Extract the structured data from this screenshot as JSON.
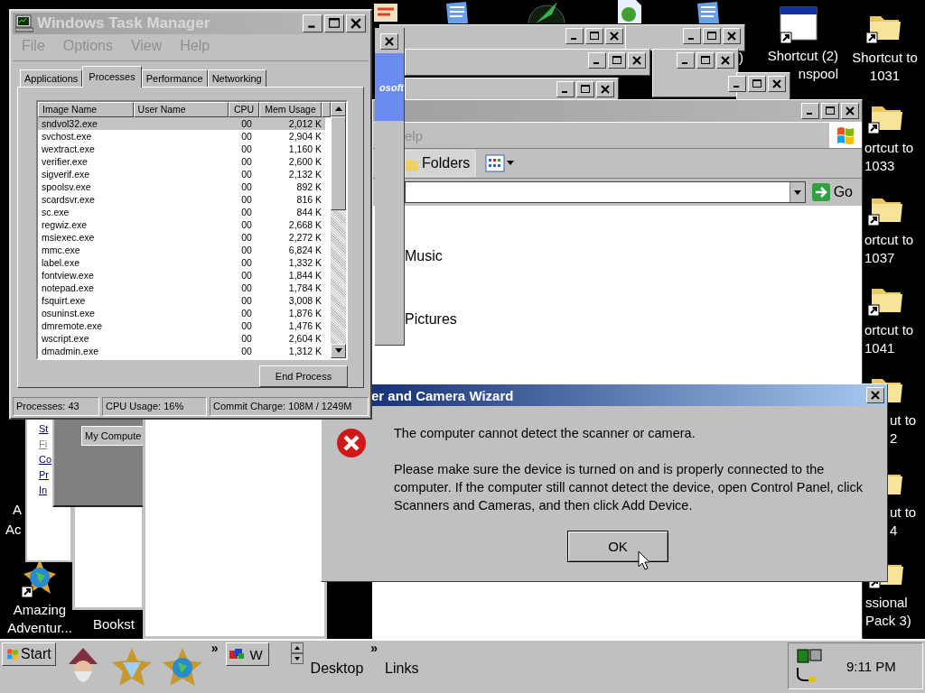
{
  "task_manager": {
    "title": "Windows Task Manager",
    "active": false,
    "menu": [
      "File",
      "Options",
      "View",
      "Help"
    ],
    "tabs": [
      {
        "label": "Applications",
        "selected": false
      },
      {
        "label": "Processes",
        "selected": true
      },
      {
        "label": "Performance",
        "selected": false
      },
      {
        "label": "Networking",
        "selected": false
      }
    ],
    "columns": [
      "Image Name",
      "User Name",
      "CPU",
      "Mem Usage"
    ],
    "rows": [
      {
        "image_name": "sndvol32.exe",
        "cpu": "00",
        "mem_usage": "2,012 K",
        "selected": true
      },
      {
        "image_name": "svchost.exe",
        "cpu": "00",
        "mem_usage": "2,904 K",
        "selected": false
      },
      {
        "image_name": "wextract.exe",
        "cpu": "00",
        "mem_usage": "1,160 K",
        "selected": false
      },
      {
        "image_name": "verifier.exe",
        "cpu": "00",
        "mem_usage": "2,600 K",
        "selected": false
      },
      {
        "image_name": "sigverif.exe",
        "cpu": "00",
        "mem_usage": "2,132 K",
        "selected": false
      },
      {
        "image_name": "spoolsv.exe",
        "cpu": "00",
        "mem_usage": "892 K",
        "selected": false
      },
      {
        "image_name": "scardsvr.exe",
        "cpu": "00",
        "mem_usage": "816 K",
        "selected": false
      },
      {
        "image_name": "sc.exe",
        "cpu": "00",
        "mem_usage": "844 K",
        "selected": false
      },
      {
        "image_name": "regwiz.exe",
        "cpu": "00",
        "mem_usage": "2,668 K",
        "selected": false
      },
      {
        "image_name": "msiexec.exe",
        "cpu": "00",
        "mem_usage": "2,272 K",
        "selected": false
      },
      {
        "image_name": "mmc.exe",
        "cpu": "00",
        "mem_usage": "6,824 K",
        "selected": false
      },
      {
        "image_name": "label.exe",
        "cpu": "00",
        "mem_usage": "1,332 K",
        "selected": false
      },
      {
        "image_name": "fontview.exe",
        "cpu": "00",
        "mem_usage": "1,844 K",
        "selected": false
      },
      {
        "image_name": "notepad.exe",
        "cpu": "00",
        "mem_usage": "1,784 K",
        "selected": false
      },
      {
        "image_name": "fsquirt.exe",
        "cpu": "00",
        "mem_usage": "3,008 K",
        "selected": false
      },
      {
        "image_name": "osuninst.exe",
        "cpu": "00",
        "mem_usage": "1,876 K",
        "selected": false
      },
      {
        "image_name": "dmremote.exe",
        "cpu": "00",
        "mem_usage": "1,476 K",
        "selected": false
      },
      {
        "image_name": "wscript.exe",
        "cpu": "00",
        "mem_usage": "2,604 K",
        "selected": false
      },
      {
        "image_name": "dmadmin.exe",
        "cpu": "00",
        "mem_usage": "1,312 K",
        "selected": false
      }
    ],
    "end_process_button": "End Process",
    "status_bar": [
      "Processes: 43",
      "CPU Usage: 16%",
      "Commit Charge: 108M / 1249M"
    ]
  },
  "explorer": {
    "menu_fragment": "elp",
    "folders_button": "Folders",
    "go_button": "Go",
    "items": [
      "Music",
      "Pictures"
    ]
  },
  "banner_window": {
    "banner_text": "osoft"
  },
  "left_window": {
    "links": [
      "St",
      "Fi",
      "Co",
      "Pr",
      "In"
    ],
    "address_label": "My Compute"
  },
  "dialog": {
    "title": "er and Camera Wizard",
    "active": true,
    "message": "The computer cannot detect the scanner or camera.",
    "details": "Please make sure the device is turned on and is properly connected to the computer. If the computer still cannot detect the device, open Control Panel, click Scanners and Cameras, and then click Add Device.",
    "ok_button": "OK"
  },
  "desktop_fragments": [
    "A",
    "Ac",
    ")"
  ],
  "desktop_icons": [
    {
      "kind": "compass",
      "lines": [
        "Amazing",
        "Adventur..."
      ]
    },
    {
      "kind": "none",
      "lines": [
        "Bookst"
      ]
    },
    {
      "kind": "window",
      "lines": [
        "Shortcut (2)",
        "nspool"
      ]
    },
    {
      "kind": "folder",
      "lines": [
        "Shortcut to",
        "1031"
      ]
    },
    {
      "kind": "folder",
      "lines": [
        "ortcut to",
        "1033"
      ]
    },
    {
      "kind": "folder",
      "lines": [
        "ortcut to",
        "1037"
      ]
    },
    {
      "kind": "folder",
      "lines": [
        "ortcut to",
        "1041"
      ]
    },
    {
      "kind": "folder",
      "lines": [
        "ut to",
        "2"
      ]
    },
    {
      "kind": "folder",
      "lines": [
        "ut to",
        "4"
      ]
    },
    {
      "kind": "folder",
      "lines": [
        "ssional",
        "Pack 3)"
      ]
    }
  ],
  "taskbar": {
    "start_button": "Start",
    "chevrons": [
      "»",
      "»"
    ],
    "task_button": "W",
    "toolbars": [
      "Desktop",
      "Links"
    ],
    "clock": "9:11 PM"
  }
}
